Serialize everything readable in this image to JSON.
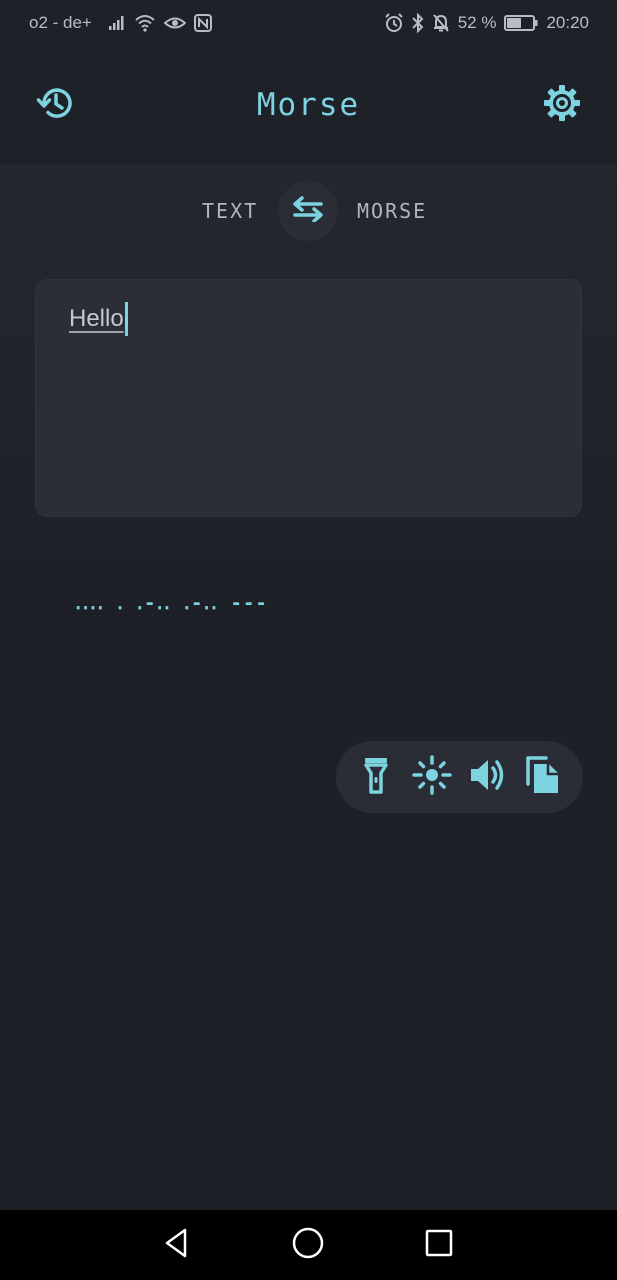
{
  "status_bar": {
    "carrier": "o2 - de+",
    "battery_percent": "52 %",
    "time": "20:20"
  },
  "app_bar": {
    "title": "Morse",
    "history_icon": "history-icon",
    "settings_icon": "gear-icon"
  },
  "mode_switch": {
    "from_label": "TEXT",
    "to_label": "MORSE",
    "swap_icon": "swap-arrows-icon"
  },
  "input": {
    "value": "Hello"
  },
  "output": {
    "morse": "․․․․ ․ ․-․․ ․-․․ ---"
  },
  "actions": [
    {
      "name": "flashlight-icon"
    },
    {
      "name": "screen-flash-icon"
    },
    {
      "name": "sound-icon"
    },
    {
      "name": "copy-icon"
    }
  ],
  "colors": {
    "accent": "#7dd3df",
    "background": "#1e2028",
    "surface": "#2b2e36"
  }
}
